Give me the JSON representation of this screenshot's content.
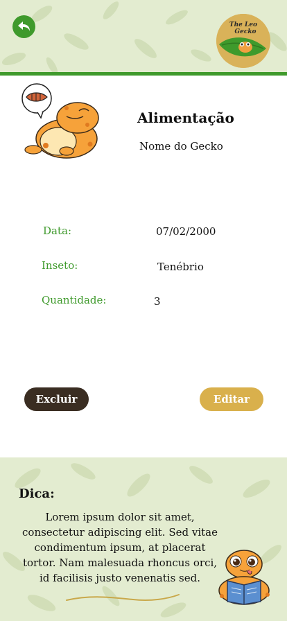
{
  "header": {
    "back_icon": "back-arrow-icon",
    "logo_text_line1": "The Leo",
    "logo_text_line2": "Gecko",
    "accent_color": "#3f9a2c"
  },
  "page": {
    "title": "Alimentação",
    "subtitle": "Nome do Gecko"
  },
  "fields": {
    "date_label": "Data:",
    "date_value": "07/02/2000",
    "insect_label": "Inseto:",
    "insect_value": "Tenébrio",
    "quantity_label": "Quantidade:",
    "quantity_value": "3"
  },
  "actions": {
    "delete_label": "Excluir",
    "edit_label": "Editar",
    "delete_color": "#3a2d22",
    "edit_color": "#d9b04c"
  },
  "tip": {
    "title": "Dica:",
    "text": "Lorem ipsum dolor sit amet, consectetur adipiscing elit. Sed vitae condimentum ipsum, at placerat tortor. Nam malesuada rhoncus orci, id facilisis justo venenatis sed."
  }
}
